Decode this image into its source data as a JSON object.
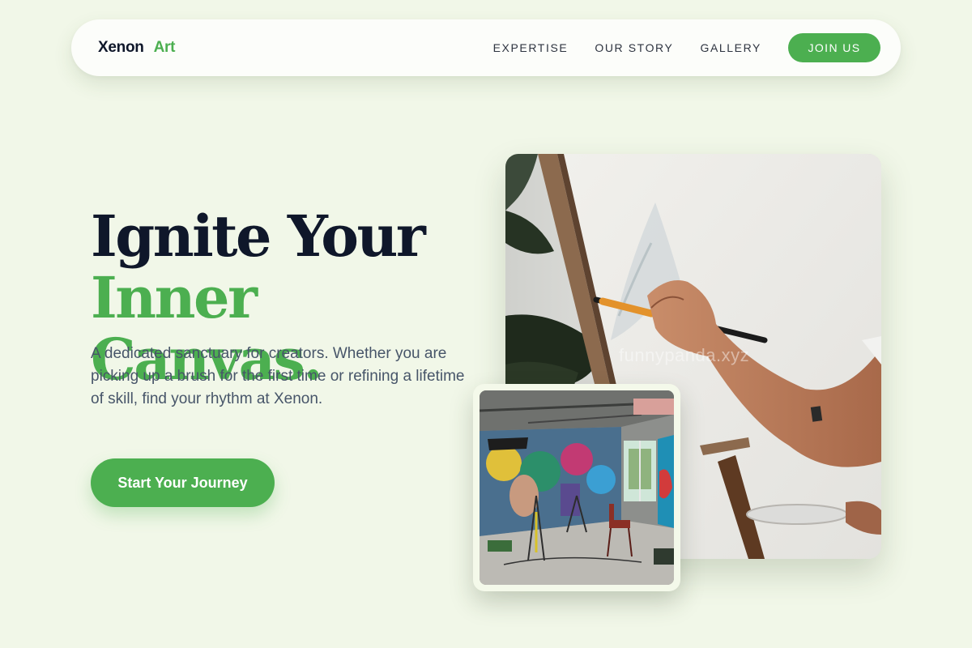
{
  "nav": {
    "logo_primary": "Xenon",
    "logo_accent": "Art",
    "links": [
      "EXPERTISE",
      "OUR STORY",
      "GALLERY"
    ],
    "cta_label": "JOIN US"
  },
  "hero": {
    "title_line1": "Ignite Your",
    "title_line2": "Inner Canvas.",
    "description": "A dedicated sanctuary for creators. Whether you are picking up a brush for the first time or refining a lifetime of skill, find your rhythm at Xenon.",
    "cta_label": "Start Your Journey"
  },
  "images": {
    "main_watermark": "funnypanda.xyz"
  },
  "colors": {
    "background": "#f1f7e8",
    "accent": "#4caf50",
    "heading": "#0f172a",
    "body_text": "#475569"
  }
}
